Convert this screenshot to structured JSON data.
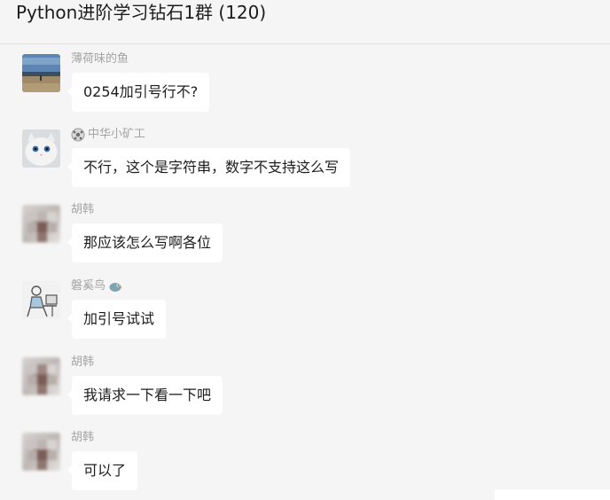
{
  "header": {
    "title": "Python进阶学习钻石1群 (120)"
  },
  "messages": [
    {
      "sender": "薄荷味的鱼",
      "text": "0254加引号行不?",
      "avatar_icon": "beach-landscape-avatar"
    },
    {
      "sender": "中华小矿工",
      "sender_icon": "ball-icon",
      "text": "不行，这个是字符串，数字不支持这么写",
      "avatar_icon": "white-cat-avatar"
    },
    {
      "sender": "胡韩",
      "text": "那应该怎么写啊各位",
      "avatar_icon": "mosaic-avatar"
    },
    {
      "sender": "磐奚鸟",
      "sender_icon": "bird-icon",
      "text": "加引号试试",
      "avatar_icon": "sketch-person-avatar"
    },
    {
      "sender": "胡韩",
      "text": "我请求一下看一下吧",
      "avatar_icon": "mosaic-avatar"
    },
    {
      "sender": "胡韩",
      "text": "可以了",
      "avatar_icon": "mosaic-avatar"
    }
  ],
  "colors": {
    "background": "#f5f5f5",
    "bubble": "#ffffff",
    "sender_name": "#a3a3a3",
    "text": "#1c1c1c"
  }
}
